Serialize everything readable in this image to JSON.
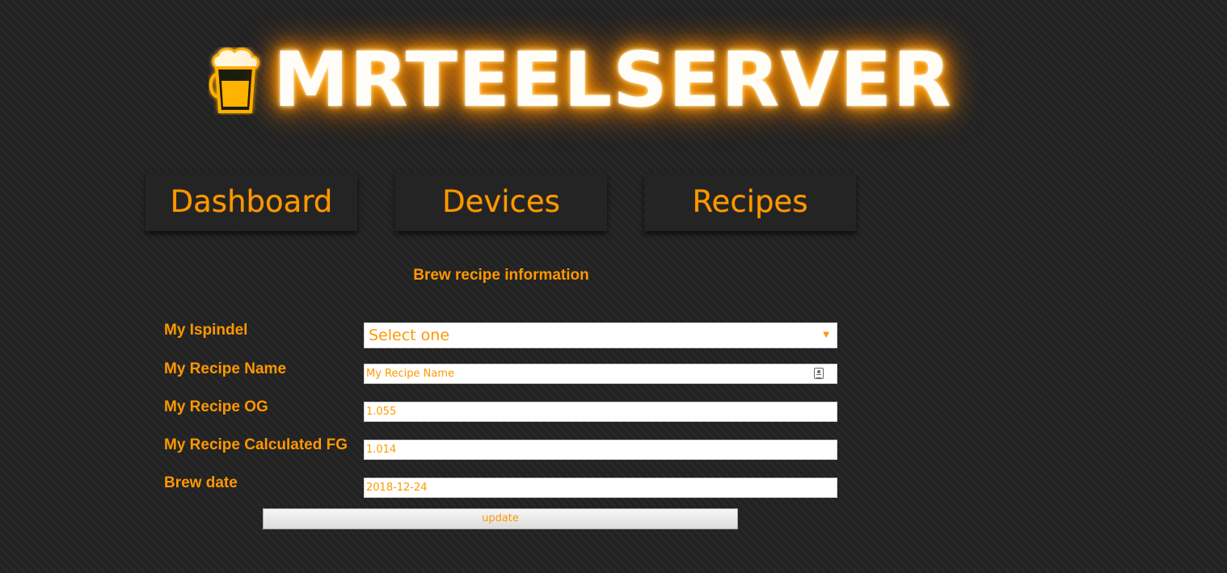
{
  "header": {
    "logo_text": "MRTEELSERVER",
    "logo_icon": "beer-mug-icon"
  },
  "nav": {
    "items": [
      {
        "label": "Dashboard"
      },
      {
        "label": "Devices"
      },
      {
        "label": "Recipes"
      }
    ]
  },
  "form": {
    "title": "Brew recipe information",
    "fields": {
      "ispindel": {
        "label": "My Ispindel",
        "value": "Select one"
      },
      "recipe_name": {
        "label": "My Recipe Name",
        "placeholder": "My Recipe Name",
        "value": ""
      },
      "recipe_og": {
        "label": "My Recipe OG",
        "value": "1.055"
      },
      "recipe_fg": {
        "label": "My Recipe Calculated FG",
        "value": "1.014"
      },
      "brew_date": {
        "label": "Brew date",
        "value": "2018-12-24"
      }
    },
    "submit_label": "update"
  },
  "colors": {
    "accent": "#ff9800",
    "background": "#222222",
    "logo_glow": "#ff8c00"
  }
}
